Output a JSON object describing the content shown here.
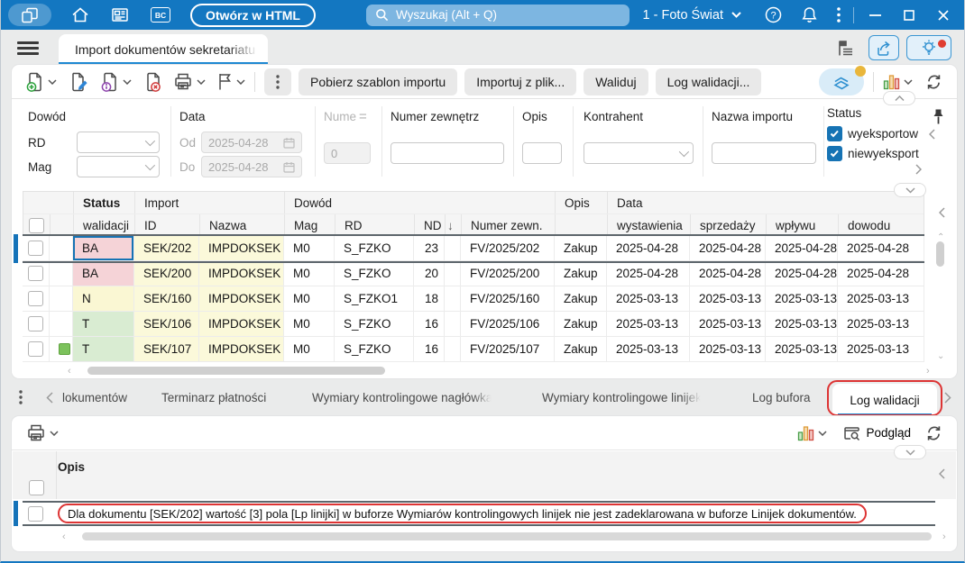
{
  "colors": {
    "titlebar": "#1377c1",
    "accent_blue": "#1e88d2",
    "selection_border": "#5d666c",
    "selection_bar": "#1573b9",
    "focus_ring": "#1673b4",
    "annotation_red": "#dd3434",
    "checkbox_checked": "#1673b4",
    "indicator_green": "#7cc25c",
    "status_bg": {
      "pink": "#f5d3d7",
      "yellow": "#faf7d3",
      "green": "#d9ecd2"
    },
    "import_cell_bg": "#fbf9da"
  },
  "titlebar": {
    "bc_badge": "BC",
    "open_html_button": "Otwórz w HTML",
    "search_placeholder": "Wyszukaj (Alt + Q)",
    "company_selector": "1 - Foto Świat"
  },
  "tabbar": {
    "active_tab": "Import dokumentów sekretariatu"
  },
  "toolbar": {
    "buttons": [
      "Pobierz szablon importu",
      "Importuj z plik...",
      "Waliduj",
      "Log walidacji..."
    ]
  },
  "filters": {
    "dowod_label": "Dowód",
    "rd_label": "RD",
    "mag_label": "Mag",
    "data_label": "Data",
    "od_label": "Od",
    "od_value": "2025-04-28",
    "do_label": "Do",
    "do_value": "2025-04-28",
    "numer_label": "Nume",
    "numer_operator": "=",
    "numer_value": "0",
    "numer_zewn_label": "Numer zewnętrz",
    "opis_label": "Opis",
    "kontrahent_label": "Kontrahent",
    "nazwa_importu_label": "Nazwa importu",
    "status_label": "Status",
    "status_options": [
      {
        "label": "wyeksportow",
        "checked": true
      },
      {
        "label": "niewyeksport",
        "checked": true
      }
    ]
  },
  "grid": {
    "group_headers": {
      "status": "Status",
      "import": "Import",
      "dowod": "Dowód",
      "opis": "Opis",
      "data": "Data"
    },
    "sub_headers": {
      "walidacji": "walidacji",
      "id": "ID",
      "nazwa": "Nazwa",
      "mag": "Mag",
      "rd": "RD",
      "nd": "ND",
      "sort_arrow": "↓",
      "numer_zewn": "Numer zewn.",
      "wystawienia": "wystawienia",
      "sprzedazy": "sprzedaży",
      "wplywu": "wpływu",
      "dowodu": "dowodu"
    },
    "rows": [
      {
        "selected": true,
        "focused": true,
        "indicator": false,
        "status": "BA",
        "status_style": "pink",
        "id": "SEK/202",
        "nazwa": "IMPDOKSEK",
        "mag": "M0",
        "rd": "S_FZKO",
        "nd": "23",
        "numer_zewn": "FV/2025/202",
        "opis": "Zakup",
        "wystawienia": "2025-04-28",
        "sprzedazy": "2025-04-28",
        "wplywu": "2025-04-28",
        "dowodu": "2025-04-28"
      },
      {
        "selected": false,
        "focused": false,
        "indicator": false,
        "status": "BA",
        "status_style": "pink",
        "id": "SEK/200",
        "nazwa": "IMPDOKSEK",
        "mag": "M0",
        "rd": "S_FZKO",
        "nd": "20",
        "numer_zewn": "FV/2025/200",
        "opis": "Zakup",
        "wystawienia": "2025-04-28",
        "sprzedazy": "2025-04-28",
        "wplywu": "2025-04-28",
        "dowodu": "2025-04-28"
      },
      {
        "selected": false,
        "focused": false,
        "indicator": false,
        "status": "N",
        "status_style": "yellow",
        "id": "SEK/160",
        "nazwa": "IMPDOKSEK",
        "mag": "M0",
        "rd": "S_FZKO1",
        "nd": "18",
        "numer_zewn": "FV/2025/160",
        "opis": "Zakup",
        "wystawienia": "2025-03-13",
        "sprzedazy": "2025-03-13",
        "wplywu": "2025-03-13",
        "dowodu": "2025-03-13"
      },
      {
        "selected": false,
        "focused": false,
        "indicator": false,
        "status": "T",
        "status_style": "green",
        "id": "SEK/106",
        "nazwa": "IMPDOKSEK",
        "mag": "M0",
        "rd": "S_FZKO",
        "nd": "16",
        "numer_zewn": "FV/2025/106",
        "opis": "Zakup",
        "wystawienia": "2025-03-13",
        "sprzedazy": "2025-03-13",
        "wplywu": "2025-03-13",
        "dowodu": "2025-03-13"
      },
      {
        "selected": false,
        "focused": false,
        "indicator": true,
        "status": "T",
        "status_style": "green",
        "id": "SEK/107",
        "nazwa": "IMPDOKSEK",
        "mag": "M0",
        "rd": "S_FZKO",
        "nd": "16",
        "numer_zewn": "FV/2025/107",
        "opis": "Zakup",
        "wystawienia": "2025-03-13",
        "sprzedazy": "2025-03-13",
        "wplywu": "2025-03-13",
        "dowodu": "2025-03-13"
      }
    ]
  },
  "bottom_tabs": {
    "tabs": [
      "lokumentów",
      "Terminarz płatności",
      "Wymiary kontrolingowe nagłówka",
      "Wymiary kontrolingowe linijek",
      "Log bufora",
      "Log walidacji"
    ],
    "active": "Log walidacji"
  },
  "bottom_panel": {
    "opis_header": "Opis",
    "preview_button": "Podgląd",
    "message": "Dla dokumentu [SEK/202] wartość [3] pola [Lp linijki] w buforze Wymiarów kontrolingowych linijek nie jest zadeklarowana w buforze Linijek dokumentów."
  }
}
